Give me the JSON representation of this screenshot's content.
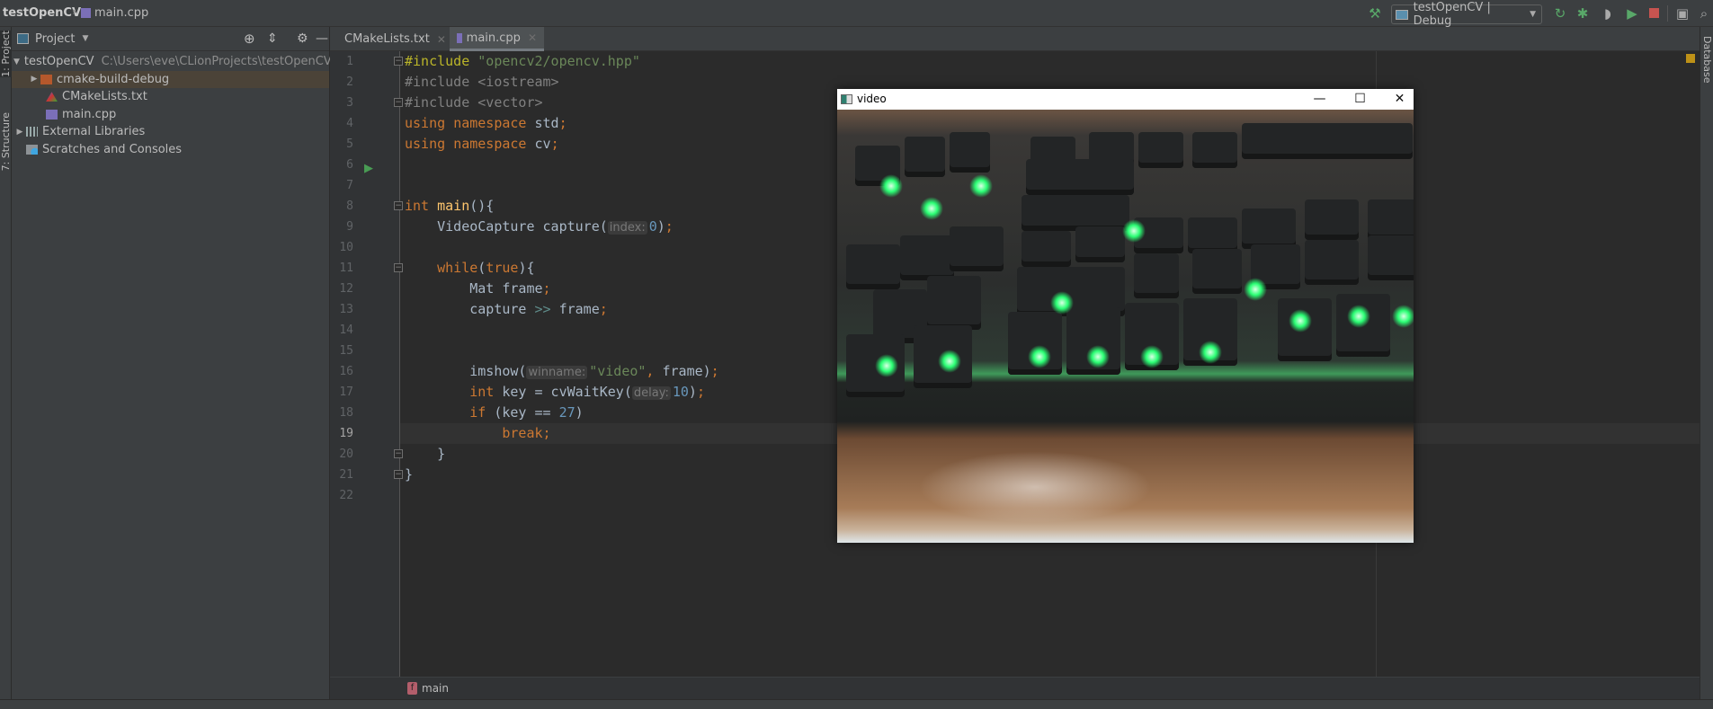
{
  "titlebar": {
    "project": "testOpenCV",
    "file": "main.cpp"
  },
  "toolbar": {
    "run_config": "testOpenCV | Debug",
    "icons": [
      "build-hammer-icon",
      "rerun-icon",
      "debug-icon",
      "coverage-icon",
      "profile-icon",
      "stop-icon",
      "terminal-icon",
      "search-icon"
    ]
  },
  "left_stripe": {
    "project_tab": "1: Project",
    "structure_tab": "7: Structure"
  },
  "right_stripe": {
    "database_tab": "Database"
  },
  "project_panel": {
    "title": "Project",
    "tree": [
      {
        "label": "testOpenCV",
        "path": "C:\\Users\\eve\\CLionProjects\\testOpenCV",
        "icon": "folder-icon",
        "expanded": true
      },
      {
        "label": "cmake-build-debug",
        "icon": "folder-icon",
        "selected": true
      },
      {
        "label": "CMakeLists.txt",
        "icon": "cmake-icon"
      },
      {
        "label": "main.cpp",
        "icon": "cpp-file-icon"
      },
      {
        "label": "External Libraries",
        "icon": "library-icon"
      },
      {
        "label": "Scratches and Consoles",
        "icon": "scratches-icon"
      }
    ]
  },
  "tabs": [
    {
      "label": "CMakeLists.txt",
      "active": false
    },
    {
      "label": "main.cpp",
      "active": true
    }
  ],
  "editor": {
    "current_line": 19,
    "lines": [
      [
        [
          "#include ",
          "pp"
        ],
        [
          "\"opencv2/opencv.hpp\"",
          "str"
        ]
      ],
      [
        [
          "#include <iostream>",
          "pp-dim"
        ]
      ],
      [
        [
          "#include <vector>",
          "pp-dim"
        ]
      ],
      [
        [
          "using ",
          "kw"
        ],
        [
          "namespace ",
          "kw"
        ],
        [
          "std",
          "txt"
        ],
        [
          ";",
          "kw"
        ]
      ],
      [
        [
          "using ",
          "kw"
        ],
        [
          "namespace ",
          "kw"
        ],
        [
          "cv",
          "txt"
        ],
        [
          ";",
          "kw"
        ]
      ],
      [],
      [],
      [
        [
          "int ",
          "kw"
        ],
        [
          "main",
          "fn"
        ],
        [
          "(){",
          "txt"
        ]
      ],
      [
        [
          "    VideoCapture capture(",
          "txt"
        ],
        [
          "index:",
          "hint"
        ],
        [
          "0",
          "num"
        ],
        [
          ")",
          "txt"
        ],
        [
          ";",
          "kw"
        ]
      ],
      [],
      [
        [
          "    ",
          "txt"
        ],
        [
          "while",
          "kw"
        ],
        [
          "(",
          "txt"
        ],
        [
          "true",
          "kw"
        ],
        [
          "){",
          "txt"
        ]
      ],
      [
        [
          "        Mat frame",
          "txt"
        ],
        [
          ";",
          "kw"
        ]
      ],
      [
        [
          "        capture ",
          "txt"
        ],
        [
          ">>",
          "op"
        ],
        [
          " frame",
          "txt"
        ],
        [
          ";",
          "kw"
        ]
      ],
      [],
      [],
      [
        [
          "        imshow(",
          "txt"
        ],
        [
          "winname:",
          "hint"
        ],
        [
          "\"video\"",
          "str"
        ],
        [
          ", ",
          "kw"
        ],
        [
          "frame)",
          "txt"
        ],
        [
          ";",
          "kw"
        ]
      ],
      [
        [
          "        ",
          "txt"
        ],
        [
          "int ",
          "kw"
        ],
        [
          "key = cvWaitKey(",
          "txt"
        ],
        [
          "delay:",
          "hint"
        ],
        [
          "10",
          "num"
        ],
        [
          ")",
          "txt"
        ],
        [
          ";",
          "kw"
        ]
      ],
      [
        [
          "        ",
          "txt"
        ],
        [
          "if ",
          "kw"
        ],
        [
          "(key == ",
          "txt"
        ],
        [
          "27",
          "num"
        ],
        [
          ")",
          "txt"
        ]
      ],
      [
        [
          "            ",
          "txt"
        ],
        [
          "break;",
          "kw"
        ]
      ],
      [
        [
          "    }",
          "txt"
        ]
      ],
      [
        [
          "}",
          "txt"
        ]
      ],
      []
    ]
  },
  "breadcrumb": {
    "function": "main"
  },
  "video_window": {
    "title": "video"
  },
  "colors": {
    "editor_bg": "#2b2b2b",
    "panel_bg": "#3c3f41",
    "keyword": "#cc7832",
    "string": "#6a8759",
    "number": "#6897bb",
    "keyboard_glow": "#2bff74"
  }
}
